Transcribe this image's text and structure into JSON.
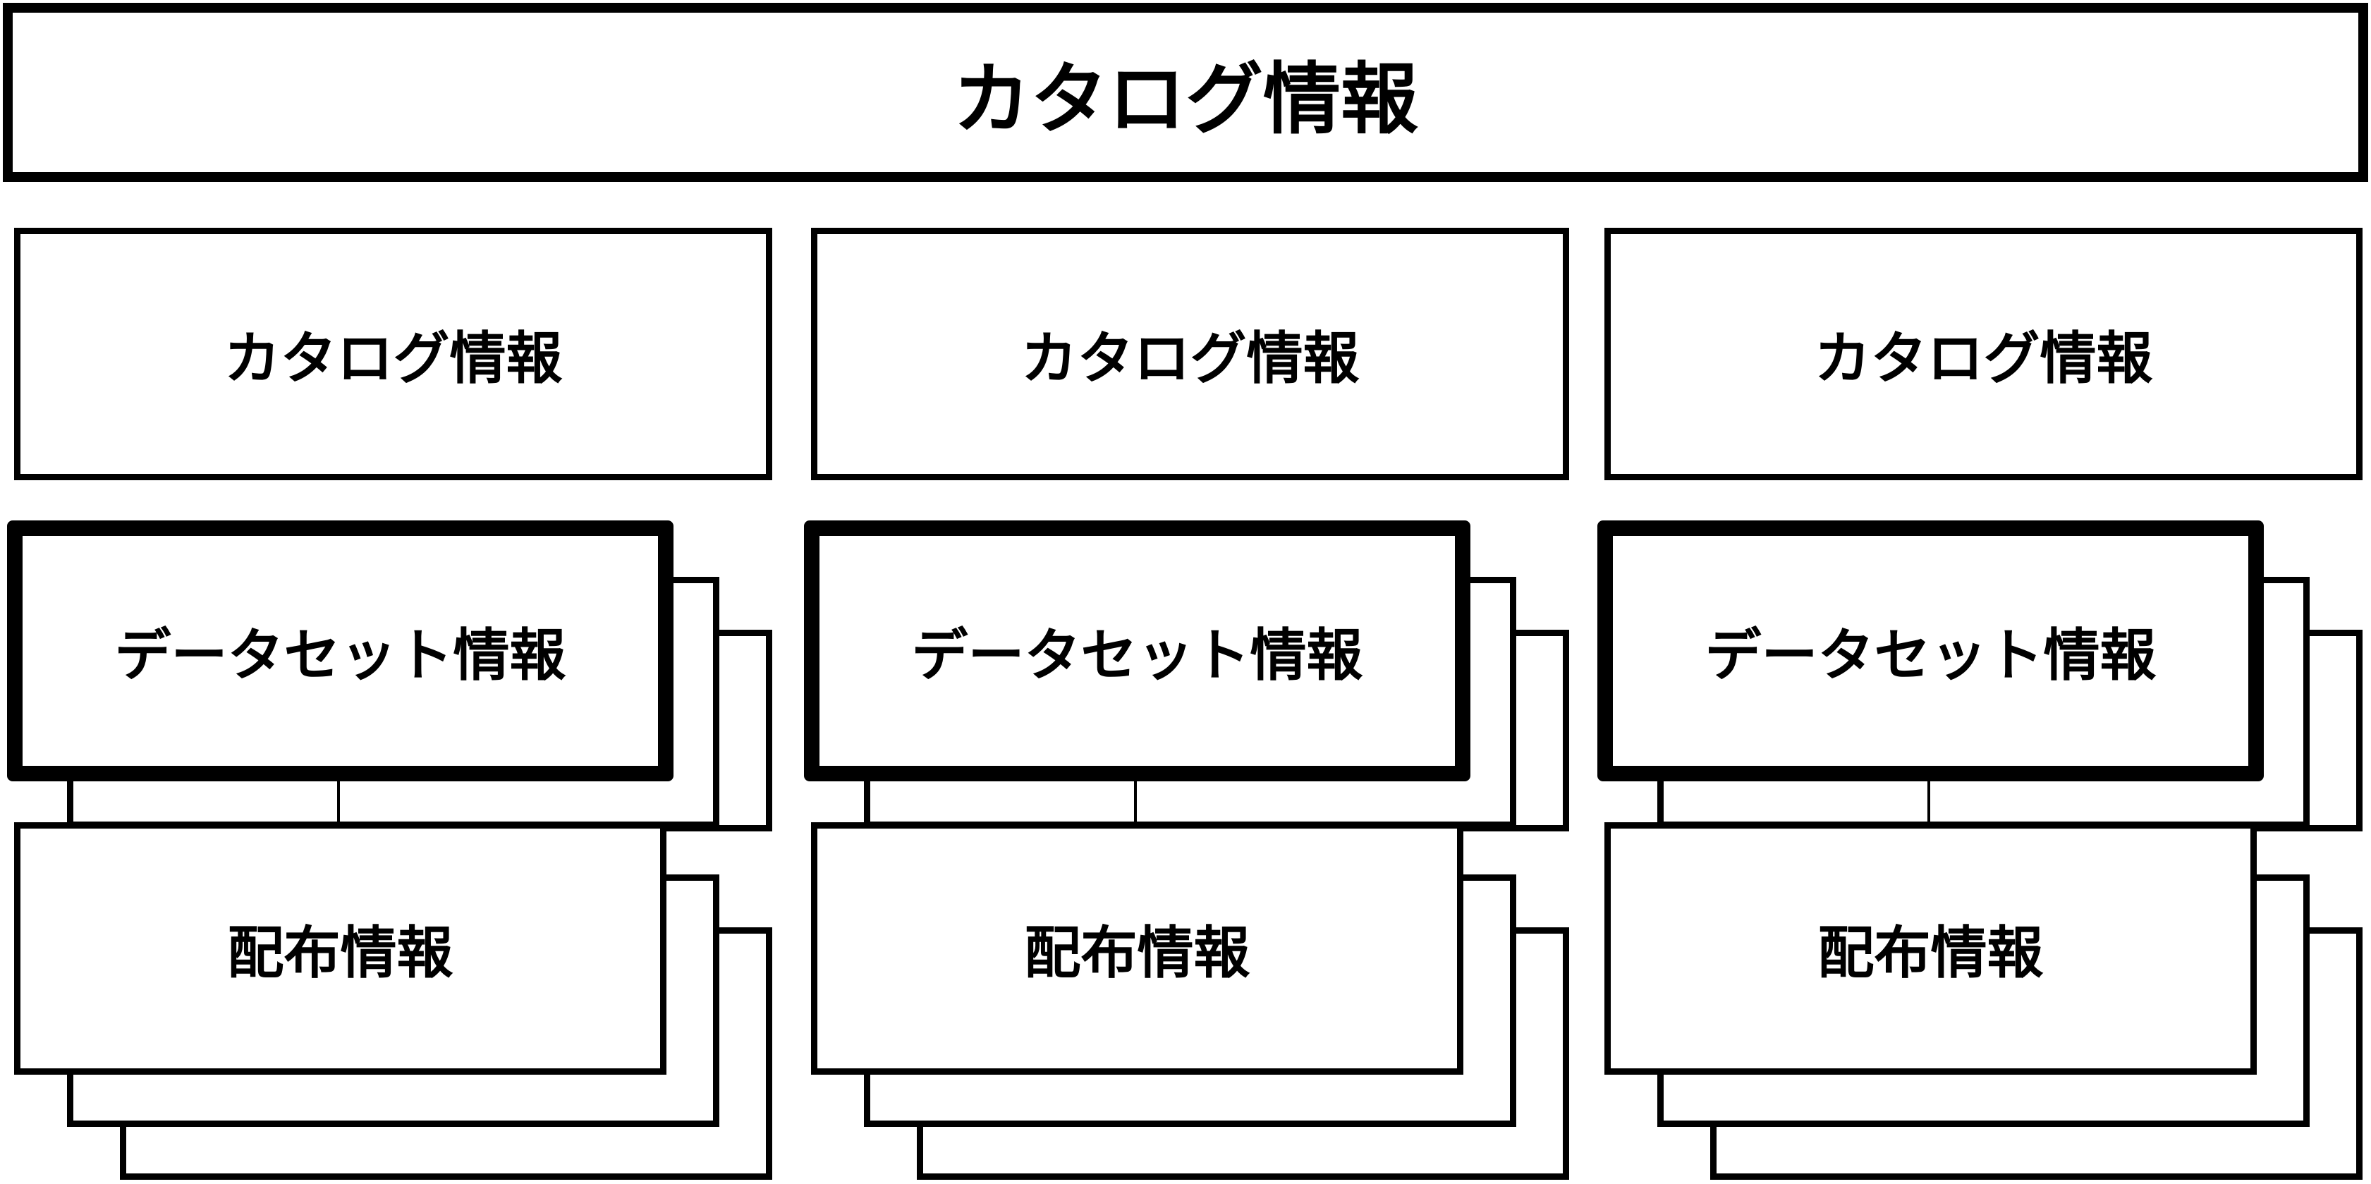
{
  "root": {
    "label": "カタログ情報"
  },
  "columns": [
    {
      "catalog": {
        "label": "カタログ情報"
      },
      "dataset": {
        "label": "データセット情報"
      },
      "distribution": {
        "label": "配布情報"
      }
    },
    {
      "catalog": {
        "label": "カタログ情報"
      },
      "dataset": {
        "label": "データセット情報"
      },
      "distribution": {
        "label": "配布情報"
      }
    },
    {
      "catalog": {
        "label": "カタログ情報"
      },
      "dataset": {
        "label": "データセット情報"
      },
      "distribution": {
        "label": "配布情報"
      }
    }
  ]
}
